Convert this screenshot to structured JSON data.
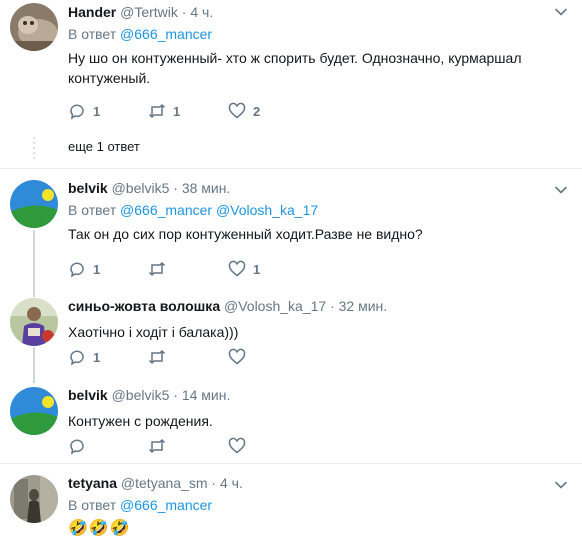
{
  "tweets": [
    {
      "name": "Hander",
      "handle": "@Tertwik",
      "time": "4 ч.",
      "reply_prefix": "В ответ",
      "reply_targets": [
        "@666_mancer"
      ],
      "text": "Ну шо он контуженный- хто ж спорить будет. Однозначно, курмаршал контуженый.",
      "replies": "1",
      "retweets": "1",
      "likes": "2"
    },
    {
      "name": "belvik",
      "handle": "@belvik5",
      "time": "38 мин.",
      "reply_prefix": "В ответ",
      "reply_targets": [
        "@666_mancer",
        "@Volosh_ka_17"
      ],
      "text": "Так он до сих пор контуженный ходит.Разве не видно?",
      "replies": "1",
      "retweets": "",
      "likes": "1"
    },
    {
      "name": "синьо-жовта волошка",
      "handle": "@Volosh_ka_17",
      "time": "32 мин.",
      "text": "Хаотічно і ходіт і балака)))",
      "replies": "1",
      "retweets": "",
      "likes": ""
    },
    {
      "name": "belvik",
      "handle": "@belvik5",
      "time": "14 мин.",
      "text": "Контужен с рождения.",
      "replies": "",
      "retweets": "",
      "likes": ""
    },
    {
      "name": "tetyana",
      "handle": "@tetyana_sm",
      "time": "4 ч.",
      "reply_prefix": "В ответ",
      "reply_targets": [
        "@666_mancer"
      ],
      "text": "🤣🤣🤣"
    }
  ],
  "more_replies": "еще 1 ответ",
  "colors": {
    "link": "#1b95e0",
    "secondary": "#657786",
    "separator": "#e6ecf0",
    "thread": "#ccd6dd"
  },
  "icons": [
    "reply-icon",
    "retweet-icon",
    "like-icon",
    "caret-down-icon"
  ]
}
